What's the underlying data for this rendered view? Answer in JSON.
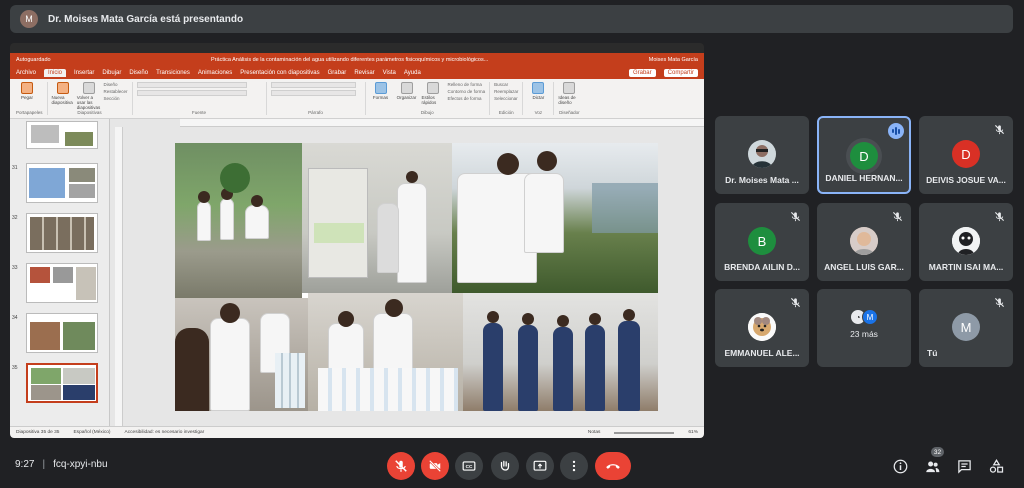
{
  "presenter": {
    "title": "Dr. Moises Mata García está presentando",
    "initials": "M"
  },
  "ppt": {
    "autosave": "Autoguardado",
    "window_title": "Práctica Análisis de la contaminación del agua utilizando diferentes parámetros fisicoquímicos y microbiológicos...",
    "user": "Moises Mata García",
    "tabs": [
      "Archivo",
      "Inicio",
      "Insertar",
      "Dibujar",
      "Diseño",
      "Transiciones",
      "Animaciones",
      "Presentación con diapositivas",
      "Grabar",
      "Revisar",
      "Vista",
      "Ayuda"
    ],
    "record_label": "Grabar",
    "share_label": "Compartir",
    "ribbon": {
      "paste": "Pegar",
      "new_slide": "Nueva diapositiva",
      "reuse": "Volver a usar las diapositivas",
      "layout": "Diseño",
      "reset": "Restablecer",
      "section": "Sección",
      "shapes": "Formas",
      "arrange": "Organizar",
      "quick_styles": "Estilos rápidos",
      "find": "Buscar",
      "replace": "Reemplazar",
      "select": "Seleccionar",
      "dictate": "Dictar",
      "designer": "Ideas de diseño",
      "g_clipboard": "Portapapeles",
      "g_slides": "Diapositivas",
      "g_font": "Fuente",
      "g_paragraph": "Párrafo",
      "g_drawing": "Dibujo",
      "g_editing": "Edición",
      "g_voice": "Voz",
      "g_designer": "Diseñador",
      "fill": "Relleno de forma",
      "outline": "Contorno de forma",
      "effects": "Efectos de forma"
    },
    "thumb_numbers": [
      "31",
      "32",
      "33",
      "34",
      "35"
    ],
    "status": {
      "slide": "Diapositiva 35 de 35",
      "language": "Español (México)",
      "accessibility": "Accesibilidad: es necesario investigar",
      "notes": "Notas",
      "zoom": "61%"
    }
  },
  "participants": [
    {
      "name": "Dr. Moises Mata ...",
      "initial": "",
      "color": "#5f6368",
      "photo": true
    },
    {
      "name": "DANIEL HERNAN...",
      "initial": "D",
      "color": "#1e8e3e",
      "speaking": true
    },
    {
      "name": "DEIVIS JOSUE VA...",
      "initial": "D",
      "color": "#d93025",
      "muted": true
    },
    {
      "name": "BRENDA AILIN D...",
      "initial": "B",
      "color": "#1e8e3e",
      "muted": true
    },
    {
      "name": "ANGEL LUIS GAR...",
      "initial": "",
      "color": "#b0a08e",
      "photo": true,
      "muted": true
    },
    {
      "name": "MARTIN ISAI MA...",
      "initial": "",
      "color": "#e8eaed",
      "photo": true,
      "muted": true
    },
    {
      "name": "EMMANUEL ALE...",
      "initial": "",
      "color": "#f5f0e6",
      "photo": true,
      "muted": true
    },
    {
      "name": "23 más",
      "initial": "M",
      "color": "#1a73e8",
      "more": true
    },
    {
      "name": "Tú",
      "initial": "M",
      "color": "#8e9aa7",
      "muted": true
    }
  ],
  "meeting": {
    "time": "9:27",
    "separator": "|",
    "code": "fcq-xpyi-nbu",
    "people_count": "32"
  },
  "controls": [
    "mic-off",
    "camera-off",
    "captions",
    "raise-hand",
    "present",
    "more-options",
    "leave-call"
  ],
  "colors": {
    "ppt_accent": "#c43e1c",
    "danger": "#ea4335",
    "tile_bg": "#3c4043",
    "speaking": "#8ab4f8"
  }
}
